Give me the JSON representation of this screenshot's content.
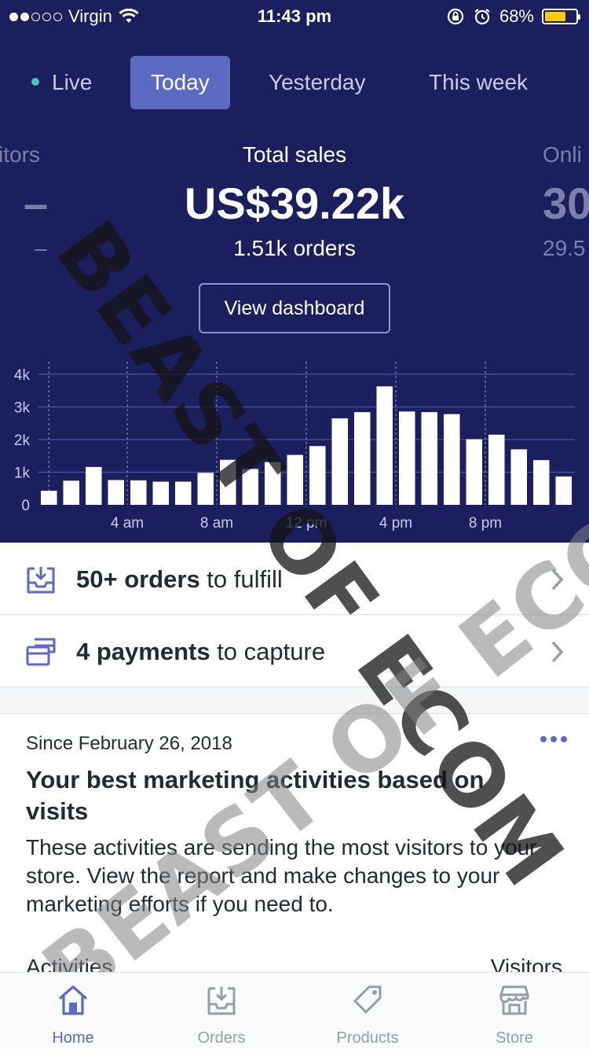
{
  "status_bar": {
    "carrier": "Virgin",
    "time": "11:43 pm",
    "battery": "68%",
    "battery_level": 0.68
  },
  "tabs": [
    {
      "label": "Live",
      "active": false
    },
    {
      "label": "Today",
      "active": true
    },
    {
      "label": "Yesterday",
      "active": false
    },
    {
      "label": "This week",
      "active": false
    }
  ],
  "metrics": {
    "left_label": "itors",
    "left_value": "–",
    "left_sub": "–",
    "center_label": "Total sales",
    "center_value": "US$39.22k",
    "center_sub": "1.51k orders",
    "right_label": "Onli",
    "right_value": "30",
    "right_sub": "29.5"
  },
  "view_dashboard": "View dashboard",
  "chart_data": {
    "type": "bar",
    "ylim": [
      0,
      4000
    ],
    "yticks": [
      "4k",
      "3k",
      "2k",
      "1k",
      "0"
    ],
    "ytick_values": [
      4000,
      3000,
      2000,
      1000,
      0
    ],
    "xticks": [
      {
        "hour": 4,
        "label": "4 am"
      },
      {
        "hour": 8,
        "label": "8 am"
      },
      {
        "hour": 12,
        "label": "12 pm"
      },
      {
        "hour": 16,
        "label": "4 pm"
      },
      {
        "hour": 20,
        "label": "8 pm"
      }
    ],
    "hours": [
      0,
      1,
      2,
      3,
      4,
      5,
      6,
      7,
      8,
      9,
      10,
      11,
      12,
      13,
      14,
      15,
      16,
      17,
      18,
      19,
      20,
      21,
      22,
      23
    ],
    "values": [
      430,
      740,
      1160,
      760,
      750,
      710,
      710,
      980,
      1380,
      1100,
      1310,
      1530,
      1800,
      2650,
      2840,
      3630,
      2860,
      2840,
      2780,
      2010,
      2150,
      1700,
      1370,
      870
    ],
    "grid": true
  },
  "action_rows": [
    {
      "bold": "50+ orders",
      "rest": " to fulfill",
      "icon": "inbox-download-icon"
    },
    {
      "bold": "4 payments",
      "rest": " to capture",
      "icon": "payments-icon"
    }
  ],
  "marketing_card": {
    "since": "Since February 26, 2018",
    "title": "Your best marketing activities based on visits",
    "body": "These activities are sending the most visitors to your store. View the report and make changes to your marketing efforts if you need to.",
    "col_left": "Activities",
    "col_right": "Visitors"
  },
  "tab_bar": [
    {
      "label": "Home",
      "icon": "home-icon",
      "active": true
    },
    {
      "label": "Orders",
      "icon": "orders-icon",
      "active": false
    },
    {
      "label": "Products",
      "icon": "products-tag-icon",
      "active": false
    },
    {
      "label": "Store",
      "icon": "store-icon",
      "active": false
    }
  ],
  "watermark": "BEAST OF ECOM",
  "colors": {
    "header_bg": "#1c1f5e",
    "accent": "#5c6ac4",
    "live_dot": "#47c1bf",
    "battery": "#ffcc00"
  }
}
